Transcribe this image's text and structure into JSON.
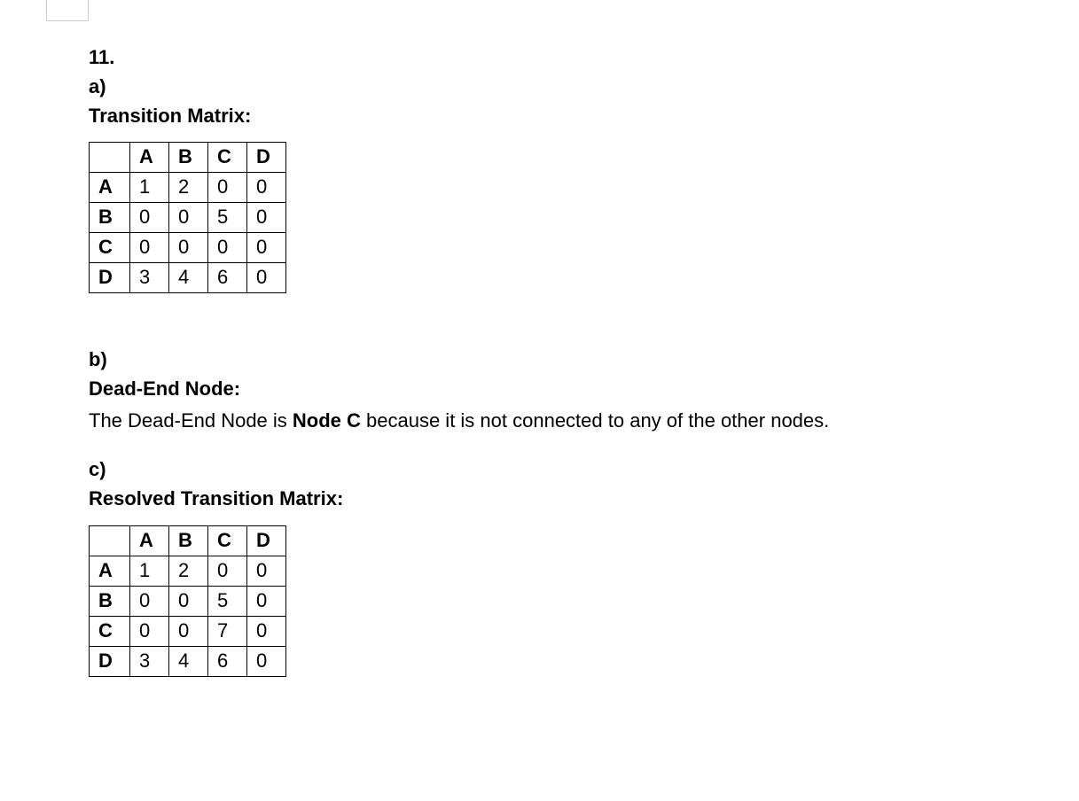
{
  "question_number": "11.",
  "part_a": {
    "label": "a)",
    "title": "Transition Matrix:",
    "matrix": {
      "col_headers": [
        "A",
        "B",
        "C",
        "D"
      ],
      "rows": [
        {
          "header": "A",
          "cells": [
            "1",
            "2",
            "0",
            "0"
          ]
        },
        {
          "header": "B",
          "cells": [
            "0",
            "0",
            "5",
            "0"
          ]
        },
        {
          "header": "C",
          "cells": [
            "0",
            "0",
            "0",
            "0"
          ]
        },
        {
          "header": "D",
          "cells": [
            "3",
            "4",
            "6",
            "0"
          ]
        }
      ]
    }
  },
  "part_b": {
    "label": "b)",
    "title": "Dead-End Node:",
    "text_before": "The Dead-End Node is ",
    "bold_text": "Node C",
    "text_after": " because it is not connected to any of the other nodes."
  },
  "part_c": {
    "label": "c)",
    "title": "Resolved Transition Matrix:",
    "matrix": {
      "col_headers": [
        "A",
        "B",
        "C",
        "D"
      ],
      "rows": [
        {
          "header": "A",
          "cells": [
            "1",
            "2",
            "0",
            "0"
          ]
        },
        {
          "header": "B",
          "cells": [
            "0",
            "0",
            "5",
            "0"
          ]
        },
        {
          "header": "C",
          "cells": [
            "0",
            "0",
            "7",
            "0"
          ]
        },
        {
          "header": "D",
          "cells": [
            "3",
            "4",
            "6",
            "0"
          ]
        }
      ]
    }
  }
}
